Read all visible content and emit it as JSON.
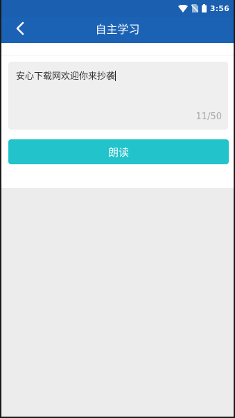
{
  "status_bar": {
    "time": "3:56",
    "icons": [
      "wifi-icon",
      "no-sim-icon",
      "battery-icon"
    ]
  },
  "header": {
    "back_icon": "chevron-left-icon",
    "title": "自主学习"
  },
  "input": {
    "value": "安心下载网欢迎你来抄袭",
    "counter": "11/50"
  },
  "actions": {
    "read_label": "朗读"
  },
  "colors": {
    "header": "#1b62b5",
    "button": "#22c3cb",
    "background": "#ececec"
  }
}
